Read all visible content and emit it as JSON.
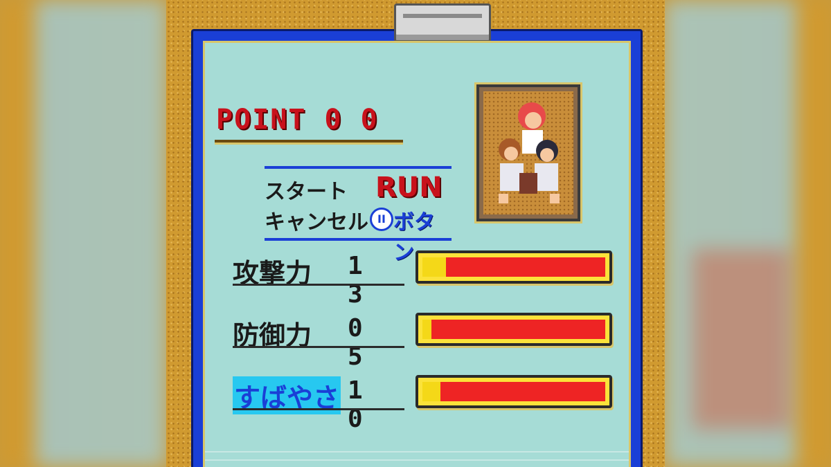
{
  "point": {
    "label": "POINT",
    "value": "0 0"
  },
  "controls": {
    "start_label": "スタート",
    "start_button": "RUN",
    "cancel_label": "キャンセル",
    "cancel_button_glyph": "II",
    "cancel_button_text": "ボタン"
  },
  "stats": [
    {
      "name": "攻撃力",
      "value": "1 3",
      "fill": 0.13,
      "highlighted": false
    },
    {
      "name": "防御力",
      "value": "0 5",
      "fill": 0.05,
      "highlighted": false
    },
    {
      "name": "すばやさ",
      "value": "1 0",
      "fill": 0.1,
      "highlighted": true
    }
  ],
  "colors": {
    "bar_red": "#ee2424",
    "bar_yellow": "#f4d818",
    "accent_blue": "#1a3fd6",
    "highlight": "#27c8f0"
  }
}
